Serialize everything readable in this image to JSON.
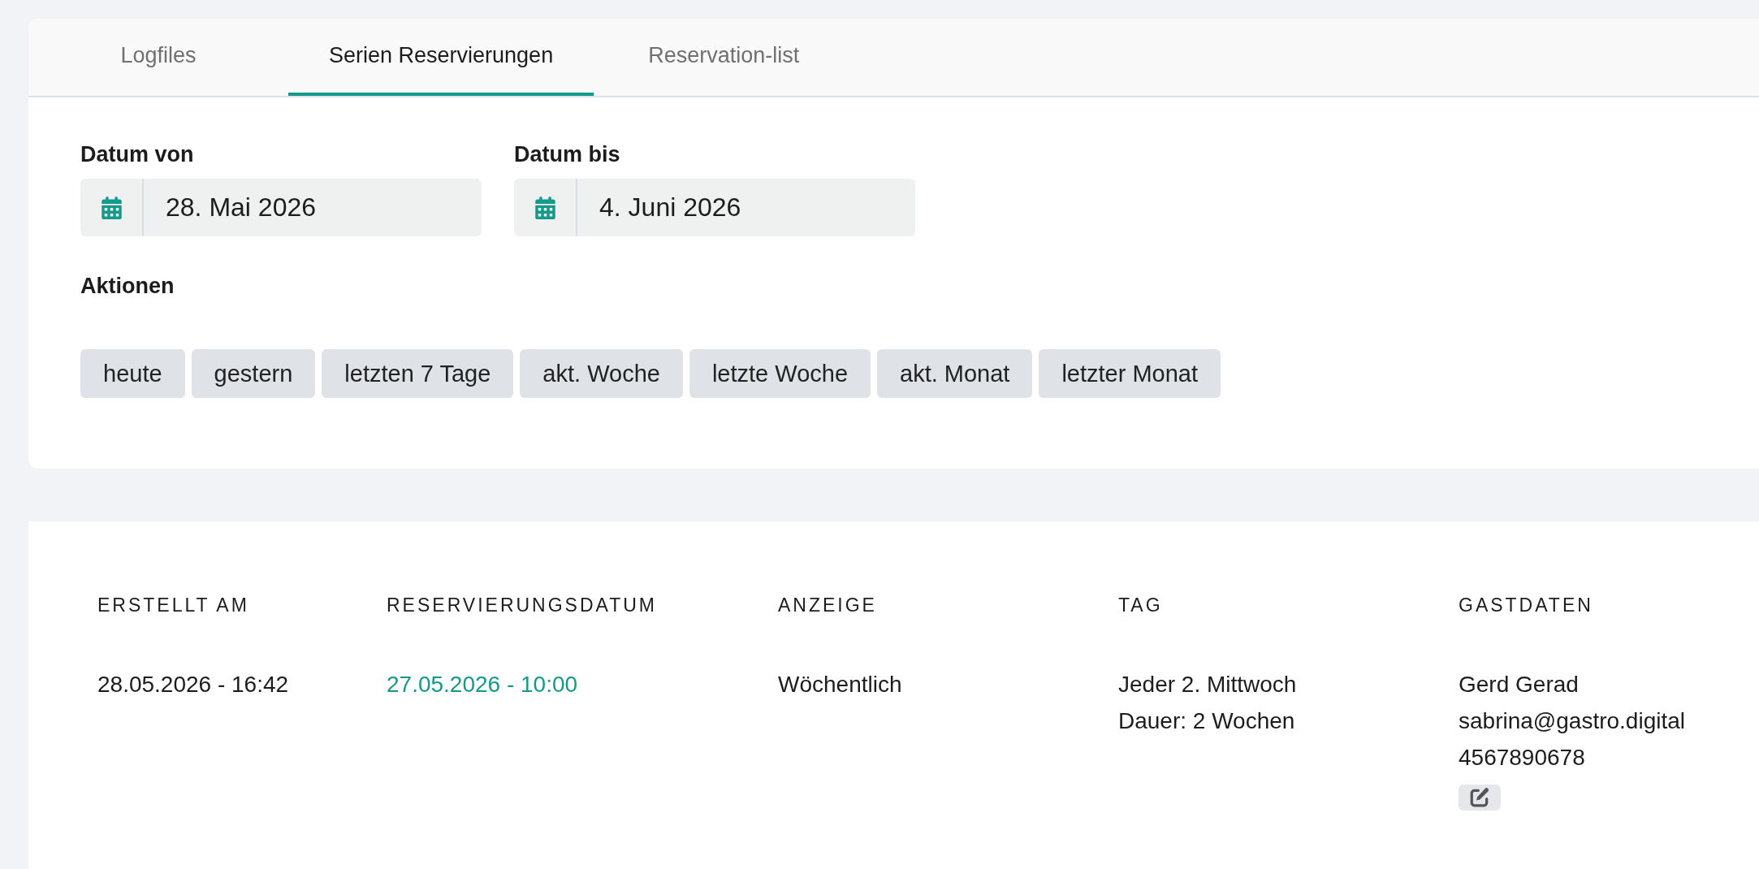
{
  "tabs": [
    {
      "label": "Logfiles",
      "selected": false
    },
    {
      "label": "Serien Reservierungen",
      "selected": true
    },
    {
      "label": "Reservation-list",
      "selected": false
    }
  ],
  "filters": {
    "date_fields": [
      {
        "label": "Datum von",
        "value": "28. Mai 2026"
      },
      {
        "label": "Datum bis",
        "value": "4. Juni 2026"
      }
    ],
    "actions_label": "Aktionen",
    "actions": [
      "heute",
      "gestern",
      "letzten 7 Tage",
      "akt. Woche",
      "letzte Woche",
      "akt. Monat",
      "letzter Monat"
    ]
  },
  "table": {
    "columns": [
      "ERSTELLT AM",
      "RESERVIERUNGSDATUM",
      "ANZEIGE",
      "TAG",
      "GASTDATEN"
    ],
    "rows": [
      {
        "cells": [
          {
            "kind": "text",
            "lines": [
              "28.05.2026 - 16:42"
            ]
          },
          {
            "kind": "link",
            "lines": [
              "27.05.2026 - 10:00"
            ]
          },
          {
            "kind": "text",
            "lines": [
              "Wöchentlich"
            ]
          },
          {
            "kind": "text",
            "lines": [
              "Jeder 2. Mittwoch",
              "Dauer: 2 Wochen"
            ]
          },
          {
            "kind": "guest",
            "lines": [
              "Gerd Gerad",
              "sabrina@gastro.digital",
              "4567890678"
            ]
          }
        ]
      }
    ]
  }
}
